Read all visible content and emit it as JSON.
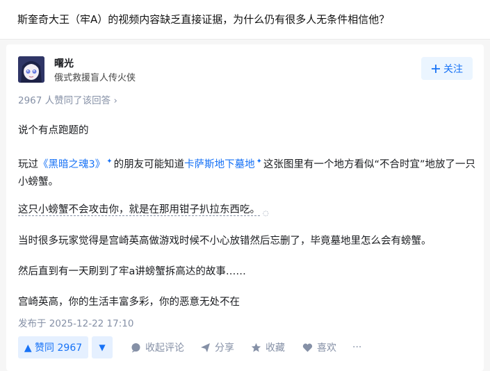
{
  "question": {
    "title": "斯奎奇大王（牢A）的视频内容缺乏直接证据，为什么仍有很多人无条件相信他？"
  },
  "author": {
    "name": "曙光",
    "bio": "俄式救援盲人传火侠",
    "follow_label": "关注"
  },
  "vote_summary": "2967 人赞同了该回答 ›",
  "content": {
    "p1": "说个有点跑题的",
    "p2_prefix": "玩过",
    "p2_link1": "《黑暗之魂3》",
    "p2_middle": "的朋友可能知道",
    "p2_link2": "卡萨斯地下墓地",
    "p2_suffix": "这张图里有一个地方看似“不合时宜”地放了一只小螃蟹。",
    "p3": "这只小螃蟹不会攻击你，就是在那用钳子扒拉东西吃。",
    "p4": "当时很多玩家觉得是宫崎英高做游戏时候不小心放错然后忘删了，毕竟墓地里怎么会有螃蟹。",
    "p5": "然后直到有一天刷到了牢a讲螃蟹拆高达的故事……",
    "p6": "宫崎英高，你的生活丰富多彩，你的恶意无处不在"
  },
  "published": "发布于 2025-12-22 17:10",
  "actions": {
    "vote_up_label": "▲ 赞同 2967",
    "vote_down_label": "▼",
    "collapse_comments": "收起评论",
    "share": "分享",
    "favorite": "收藏",
    "like": "喜欢",
    "more": "···"
  },
  "colors": {
    "accent": "#1772f6",
    "muted": "#8590a6",
    "vote_bg": "#e5f0ff"
  }
}
